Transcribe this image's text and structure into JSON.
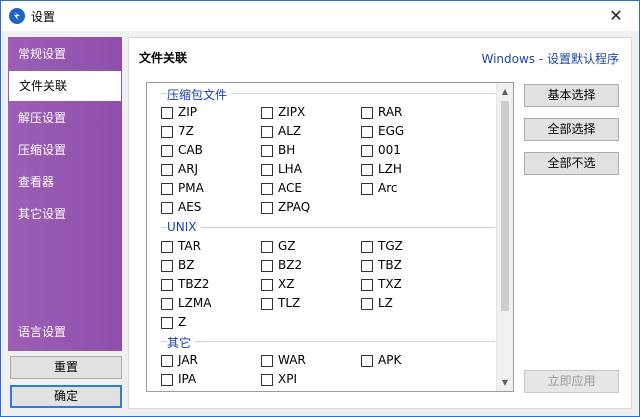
{
  "window": {
    "title": "设置",
    "close_glyph": "✕"
  },
  "sidebar": {
    "items": [
      {
        "label": "常规设置"
      },
      {
        "label": "文件关联"
      },
      {
        "label": "解压设置"
      },
      {
        "label": "压缩设置"
      },
      {
        "label": "查看器"
      },
      {
        "label": "其它设置"
      }
    ],
    "language": "语言设置",
    "reset_label": "重置",
    "ok_label": "确定"
  },
  "content": {
    "title": "文件关联",
    "link": "Windows - 设置默认程序"
  },
  "groups": [
    {
      "label": "压缩包文件",
      "items": [
        "ZIP",
        "ZIPX",
        "RAR",
        "7Z",
        "ALZ",
        "EGG",
        "CAB",
        "BH",
        "001",
        "ARJ",
        "LHA",
        "LZH",
        "PMA",
        "ACE",
        "Arc",
        "AES",
        "ZPAQ"
      ]
    },
    {
      "label": "UNIX",
      "items": [
        "TAR",
        "GZ",
        "TGZ",
        "BZ",
        "BZ2",
        "TBZ",
        "TBZ2",
        "XZ",
        "TXZ",
        "LZMA",
        "TLZ",
        "LZ",
        "Z"
      ]
    },
    {
      "label": "其它",
      "items": [
        "JAR",
        "WAR",
        "APK",
        "IPA",
        "XPI"
      ]
    }
  ],
  "actions": {
    "basic": "基本选择",
    "all": "全部选择",
    "none": "全部不选",
    "apply": "立即应用"
  },
  "icons": {
    "app": "app-logo-icon",
    "scroll_up": "▲",
    "scroll_down": "▼"
  }
}
